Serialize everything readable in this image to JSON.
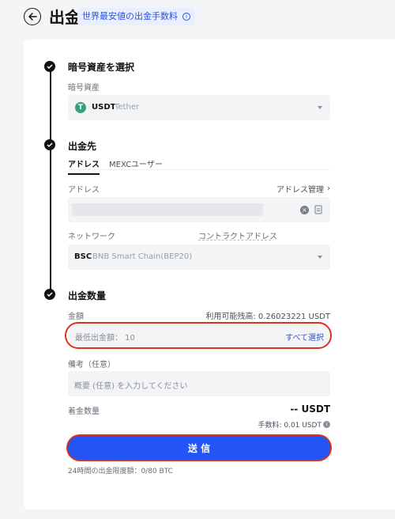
{
  "header": {
    "title": "出金",
    "fee_badge": "世界最安値の出金手数料",
    "fee_info": "i"
  },
  "step1": {
    "title": "暗号資産を選択",
    "asset_label": "暗号資産",
    "asset_symbol": "USDT",
    "asset_name": "Tether",
    "asset_icon_glyph": "T"
  },
  "step2": {
    "title": "出金先",
    "tabs": [
      {
        "label": "アドレス",
        "active": true
      },
      {
        "label": "MEXCユーザー",
        "active": false
      }
    ],
    "address_label": "アドレス",
    "address_manage": "アドレス管理",
    "network_label": "ネットワーク",
    "contract_label": "コントラクトアドレス",
    "network_symbol": "BSC",
    "network_name": "BNB Smart Chain(BEP20)"
  },
  "step3": {
    "title": "出金数量",
    "amount_label": "金額",
    "available": "利用可能残高: 0.26023221 USDT",
    "amount_placeholder": "最低出金額： 10",
    "all_button": "すべて選択",
    "memo_label": "備考（任意）",
    "memo_placeholder": "概要 (任意) を入力してください",
    "receive_label": "着金数量",
    "receive_value": "-- USDT",
    "fee_text": "手数料: 0.01 USDT",
    "submit_label": "送 信",
    "limit_text": "24時間の出金限度額：0/80 BTC"
  },
  "colors": {
    "accent": "#2355f5",
    "highlight": "#d9321f",
    "link": "#2b55d9",
    "tether_green": "#35a37a"
  }
}
